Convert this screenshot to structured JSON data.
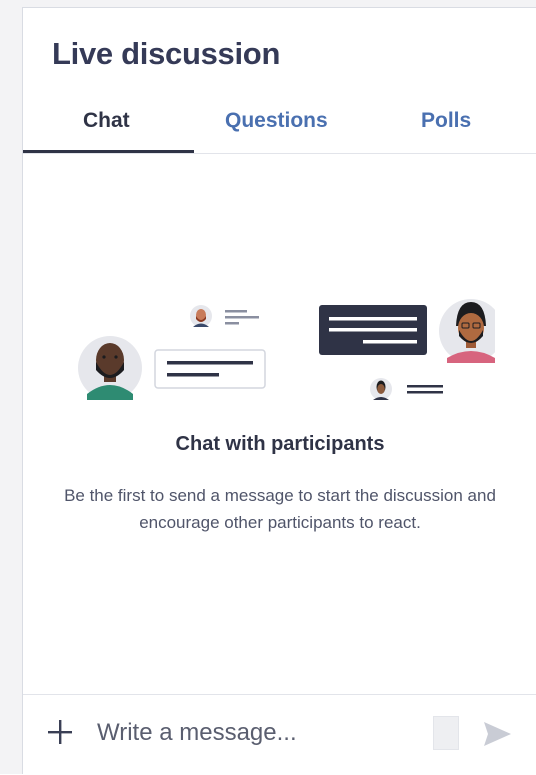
{
  "panel": {
    "title": "Live discussion"
  },
  "tabs": [
    {
      "label": "Chat",
      "active": true
    },
    {
      "label": "Questions",
      "active": false
    },
    {
      "label": "Polls",
      "active": false
    }
  ],
  "empty_state": {
    "heading": "Chat with participants",
    "description": "Be the first to send a message to start the discussion and encourage other participants to react."
  },
  "composer": {
    "placeholder": "Write a message...",
    "add_icon": "plus-icon",
    "emoji_icon": "emoji-icon",
    "send_icon": "send-icon"
  },
  "colors": {
    "title": "#353a57",
    "tab_active": "#2f3346",
    "tab_inactive": "#4a70b0",
    "bubble_dark": "#2f3346"
  }
}
